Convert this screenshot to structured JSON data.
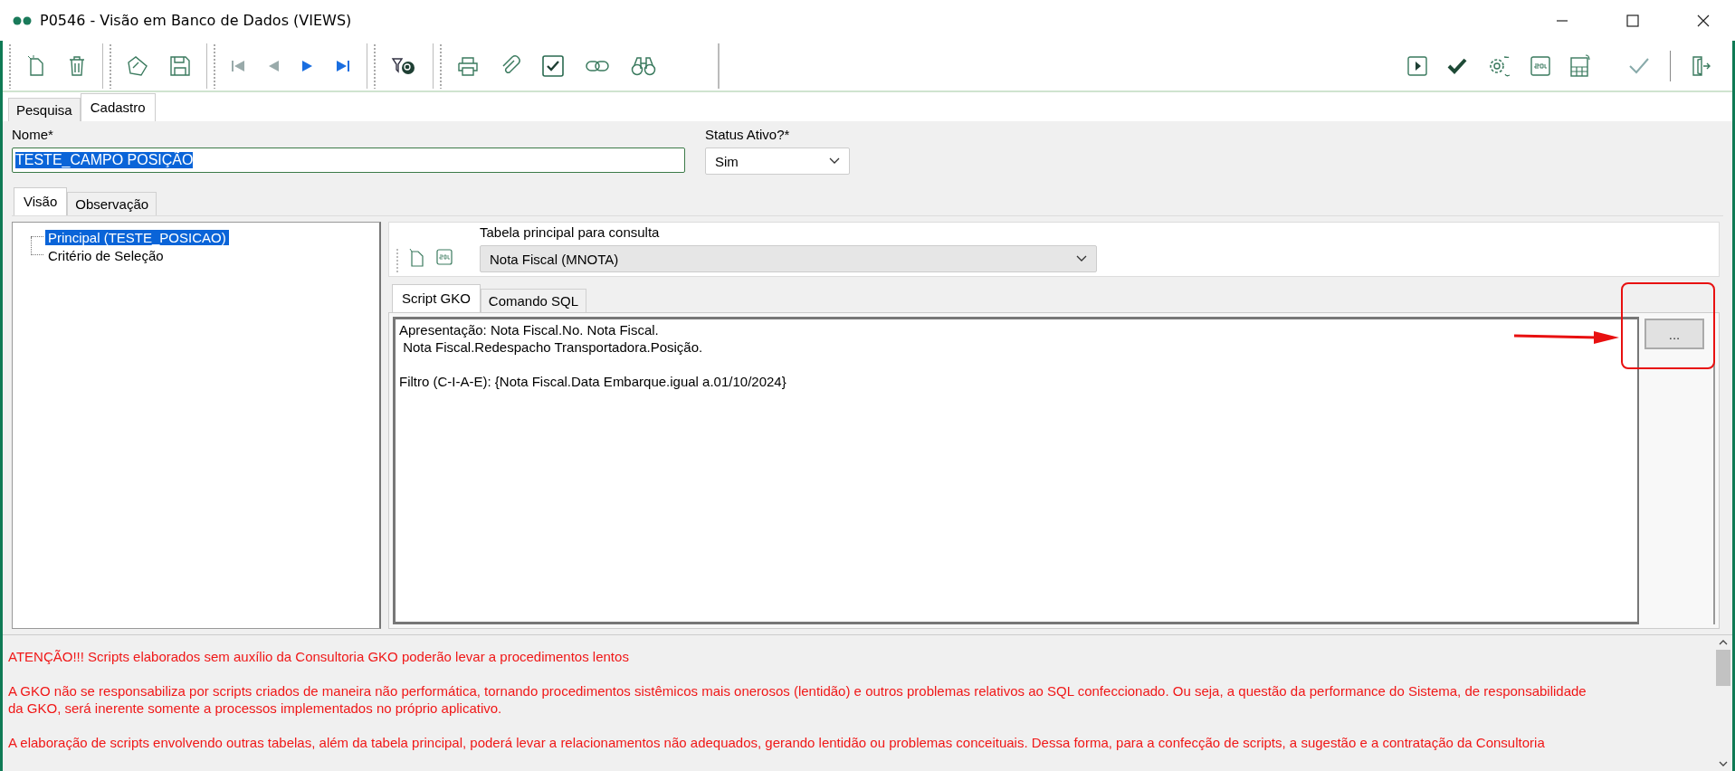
{
  "window": {
    "title": "P0546 - Visão em Banco de Dados (VIEWS)"
  },
  "main_tabs": [
    {
      "label": "Pesquisa",
      "selected": false
    },
    {
      "label": "Cadastro",
      "selected": true
    }
  ],
  "form": {
    "name_label": "Nome*",
    "name_value": "TESTE_CAMPO POSIÇÃO",
    "status_label": "Status Ativo?*",
    "status_value": "Sim"
  },
  "view_tabs": [
    {
      "label": "Visão",
      "selected": true
    },
    {
      "label": "Observação",
      "selected": false
    }
  ],
  "tree": [
    {
      "label": "Principal (TESTE_POSICAO)",
      "selected": true
    },
    {
      "label": "Critério de Seleção",
      "selected": false
    }
  ],
  "table_label": "Tabela principal para consulta",
  "table_value": "Nota Fiscal (MNOTA)",
  "script_tabs": [
    {
      "label": "Script GKO",
      "selected": true
    },
    {
      "label": "Comando SQL",
      "selected": false
    }
  ],
  "script_blocks": [
    [
      "Apresentação: Nota Fiscal.No. Nota Fiscal.",
      " Nota Fiscal.Redespacho Transportadora.Posição."
    ],
    [
      "Filtro (C-I-A-E): {Nota Fiscal.Data Embarque.igual a.01/10/2024}"
    ]
  ],
  "ellipsis_button": "...",
  "warnings": [
    "ATENÇÃO!!! Scripts elaborados sem auxílio da Consultoria GKO poderão levar a procedimentos lentos",
    "A GKO não se responsabiliza por scripts criados de maneira não performática, tornando procedimentos sistêmicos mais onerosos (lentidão) e outros problemas relativos ao SQL confeccionado. Ou seja, a questão da performance do Sistema, de responsabilidade da GKO, será inerente somente a processos implementados no próprio aplicativo.",
    "A elaboração de scripts envolvendo outras tabelas, além da tabela principal, poderá levar a relacionamentos não adequados, gerando lentidão ou problemas conceituais. Dessa forma, para a confecção de scripts, a sugestão e a contratação da Consultoria"
  ]
}
